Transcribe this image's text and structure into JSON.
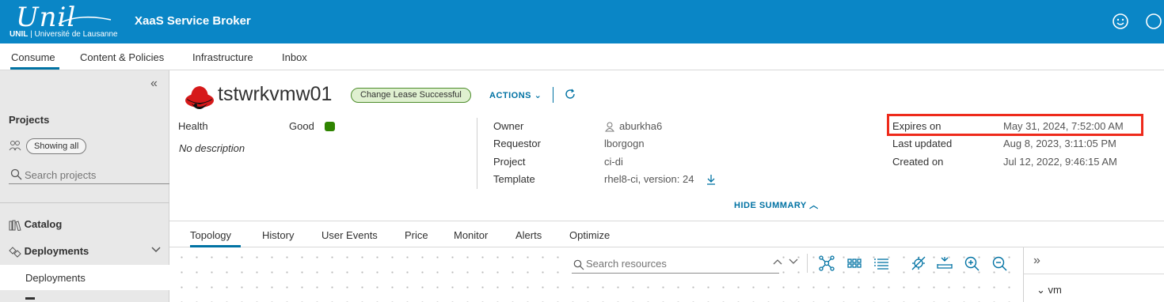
{
  "header": {
    "logo_script": "Unil",
    "logo_abbrev": "UNIL",
    "logo_university": "Université de Lausanne",
    "app_title": "XaaS Service Broker"
  },
  "nav": {
    "items": [
      "Consume",
      "Content & Policies",
      "Infrastructure",
      "Inbox"
    ],
    "active": "Consume"
  },
  "sidebar": {
    "projects_heading": "Projects",
    "filter_label": "Showing all",
    "search_placeholder": "Search projects",
    "catalog_label": "Catalog",
    "deployments_label": "Deployments",
    "deployments_sub_label": "Deployments"
  },
  "deployment": {
    "name": "tstwrkvmw01",
    "lease_badge": "Change Lease Successful",
    "actions_label": "ACTIONS",
    "health_label": "Health",
    "health_value": "Good",
    "description": "No description",
    "owner_label": "Owner",
    "owner_value": "aburkha6",
    "requestor_label": "Requestor",
    "requestor_value": "lborgogn",
    "project_label": "Project",
    "project_value": "ci-di",
    "template_label": "Template",
    "template_value": "rhel8-ci, version: 24",
    "expires_label": "Expires on",
    "expires_value": "May 31, 2024, 7:52:00 AM",
    "updated_label": "Last updated",
    "updated_value": "Aug 8, 2023, 3:11:05 PM",
    "created_label": "Created on",
    "created_value": "Jul 12, 2022, 9:46:15 AM",
    "hide_summary_label": "HIDE SUMMARY"
  },
  "tabs": {
    "items": [
      "Topology",
      "History",
      "User Events",
      "Price",
      "Monitor",
      "Alerts",
      "Optimize"
    ],
    "active": "Topology"
  },
  "topology": {
    "search_placeholder": "Search resources",
    "panel_node": "vm"
  },
  "colors": {
    "header_bg": "#0a86c6",
    "accent": "#0072a3",
    "health_good": "#2f8400",
    "highlight": "#ee2a1b",
    "badge_bg": "#dff0d0"
  }
}
